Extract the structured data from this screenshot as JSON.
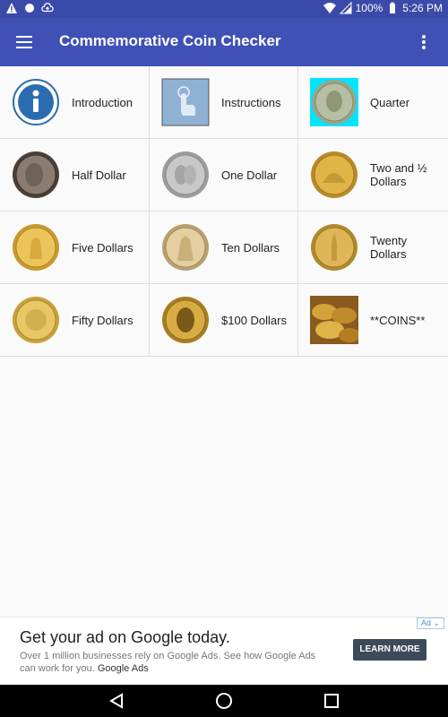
{
  "status_bar": {
    "battery": "100%",
    "time": "5:26 PM"
  },
  "app_bar": {
    "title": "Commemorative Coin Checker",
    "menu_icon": "hamburger-menu-icon",
    "overflow_icon": "more-vert-icon"
  },
  "grid": {
    "items": [
      {
        "label": "Introduction",
        "icon": "info-icon"
      },
      {
        "label": "Instructions",
        "icon": "touch-hand-icon"
      },
      {
        "label": "Quarter",
        "icon": "quarter-coin-icon"
      },
      {
        "label": "Half Dollar",
        "icon": "half-dollar-coin-icon"
      },
      {
        "label": "One Dollar",
        "icon": "one-dollar-coin-icon"
      },
      {
        "label": "Two and ½ Dollars",
        "icon": "two-and-half-dollar-coin-icon"
      },
      {
        "label": "Five Dollars",
        "icon": "five-dollar-coin-icon"
      },
      {
        "label": "Ten Dollars",
        "icon": "ten-dollar-coin-icon"
      },
      {
        "label": "Twenty Dollars",
        "icon": "twenty-dollar-coin-icon"
      },
      {
        "label": "Fifty Dollars",
        "icon": "fifty-dollar-coin-icon"
      },
      {
        "label": "$100 Dollars",
        "icon": "hundred-dollar-coin-icon"
      },
      {
        "label": "**COINS**",
        "icon": "coins-pile-icon"
      }
    ]
  },
  "ad": {
    "badge": "Ad",
    "headline": "Get your ad on Google today.",
    "body": "Over 1 million businesses rely on Google Ads. See how Google Ads can work for you.",
    "brand": "Google Ads",
    "cta": "LEARN MORE"
  },
  "colors": {
    "app_bar": "#3f51b5",
    "status_bar": "#3a4aa8",
    "gold": "#d4a83a",
    "silver": "#b8b8b8"
  }
}
